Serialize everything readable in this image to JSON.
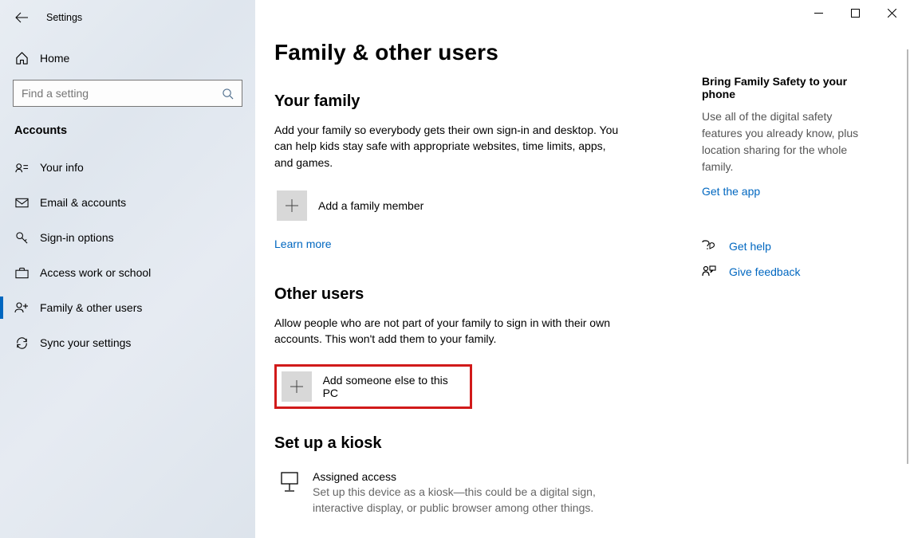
{
  "window": {
    "title": "Settings"
  },
  "sidebar": {
    "home": "Home",
    "search_placeholder": "Find a setting",
    "section": "Accounts",
    "items": [
      {
        "label": "Your info"
      },
      {
        "label": "Email & accounts"
      },
      {
        "label": "Sign-in options"
      },
      {
        "label": "Access work or school"
      },
      {
        "label": "Family & other users"
      },
      {
        "label": "Sync your settings"
      }
    ]
  },
  "page": {
    "title": "Family & other users",
    "family": {
      "heading": "Your family",
      "description": "Add your family so everybody gets their own sign-in and desktop. You can help kids stay safe with appropriate websites, time limits, apps, and games.",
      "add_label": "Add a family member",
      "learn_more": "Learn more"
    },
    "other": {
      "heading": "Other users",
      "description": "Allow people who are not part of your family to sign in with their own accounts. This won't add them to your family.",
      "add_label": "Add someone else to this PC"
    },
    "kiosk": {
      "heading": "Set up a kiosk",
      "title": "Assigned access",
      "description": "Set up this device as a kiosk—this could be a digital sign, interactive display, or public browser among other things."
    }
  },
  "aside": {
    "promo_heading": "Bring Family Safety to your phone",
    "promo_text": "Use all of the digital safety features you already know, plus location sharing for the whole family.",
    "promo_link": "Get the app",
    "help": "Get help",
    "feedback": "Give feedback"
  }
}
